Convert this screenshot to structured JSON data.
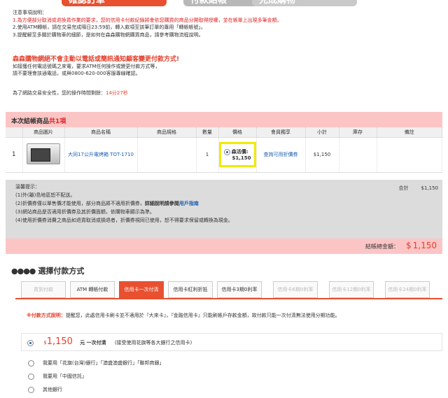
{
  "steps": {
    "step1": "確認訂單",
    "step2": "付款結帳",
    "step3": "完成購物"
  },
  "notes": {
    "title": "注意事項說明：",
    "n1": "1.為方便部分取消或退換貨作業的要求，您的信用卡付款紀錄將會依您購買的商品分開取得授權，並在帳單上出現多筆金額。",
    "n2": "2.使用ATM轉帳，請在交易完成隔日23:59前，轉入款項至該筆訂單的專用「轉帳帳號」。",
    "n3": "3.提醒解至多關於購物車的細節，是如何在森森購物網購買商品，請參考購物流程說明。"
  },
  "alert": "森森購物網絕不會主動以電話或簡訊通知顧客變更付款方式!",
  "sub": {
    "l1": "如接獲任何電話號碼之來電，要求ATM任何操作或變更付款方式等，",
    "l2": "請不要理會該通電話，或與0800-620-000客服專線確認。"
  },
  "timer": {
    "text": "為了網路交易安全性，您的操作時間剩餘：",
    "value": "14分27秒"
  },
  "cart": {
    "title": "本次結帳商品",
    "count": "共1項",
    "headers": [
      "",
      "商品圖片",
      "商品名稱",
      "商品規格",
      "數量",
      "價格",
      "會員獨享",
      "小計",
      "庫存",
      "備註"
    ],
    "row": {
      "index": "1",
      "name": "大同17公升電烤箱 TOT-1710",
      "spec": "",
      "qty": "1",
      "price_label": "森活價:",
      "price": "$1,150",
      "coupon": "查詢可用折價券",
      "subtotal": "$1,150",
      "stock": "",
      "remark": ""
    }
  },
  "tips": {
    "title": "溫馨提示：",
    "t1": "(1)外(離)島地區恕不配送。",
    "t2a": "(2)折價券僅以單售價才能使用，部分商品將不適用折價券，",
    "t2b": "詳細說明請參閱",
    "t2c": "用戶指南",
    "t3": "(3)網站商品是否適用折價券及其折價面額，依購物車顯示為準。",
    "t4": "(4)使用折價券消費之商品如退貨取消或損退者，折價券視同已使用，恕不得要求保留或轉換為現金。",
    "sum_label": "合計",
    "sum_value": "$1,150"
  },
  "total": {
    "label": "結帳總金額：",
    "currency": "$",
    "value": "1,150"
  },
  "payment": {
    "title": "選擇付款方式",
    "tabs": [
      "貨到付款",
      "ATM 轉帳付款",
      "信用卡一次付清",
      "信用卡紅利折抵",
      "信用卡3期0利率",
      "信用卡6期0利率",
      "信用卡12期0利率",
      "信用卡24期0利率"
    ],
    "note_label": "※付款方式說明：",
    "note_text": "提醒您，此處信用卡刷卡並不適用於『大來卡』，『金融信用卡』只能刷帳戶存款金額，故付款只能一次付清無法使用分期功能。",
    "main_currency": "$",
    "main_amount": "1,150",
    "main_label": "元 一次付清",
    "main_hint": "(接受使用花旗等各大銀行之信用卡)",
    "opt1": "我要用「花旗(台灣)銀行」「澳盛澳盛銀行」「聯邦商銀」",
    "opt2": "我要用「中國信託」",
    "opt3": "其他銀行"
  }
}
